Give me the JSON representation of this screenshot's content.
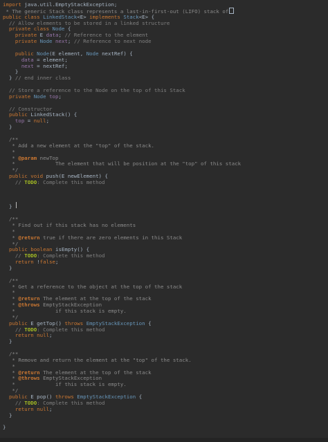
{
  "editor": {
    "language": "java",
    "colors": {
      "background": "#2b2b2b",
      "keyword": "#cc7832",
      "text": "#a9b7c6",
      "comment": "#808080",
      "field": "#9876aa",
      "todo": "#a8c023"
    },
    "lines": [
      {
        "parts": [
          {
            "c": "kw",
            "t": "import "
          },
          {
            "c": "plain",
            "t": "java.util.EmptyStackException;"
          }
        ]
      },
      {
        "parts": [
          {
            "c": "doc",
            "t": " * The generic Stack class represents a last-in-first-out (LIFO) stack of"
          }
        ],
        "box": true
      },
      {
        "parts": [
          {
            "c": "kw",
            "t": "public class "
          },
          {
            "c": "cls",
            "t": "LinkedStack"
          },
          {
            "c": "plain",
            "t": "<E> "
          },
          {
            "c": "kw",
            "t": "implements "
          },
          {
            "c": "cls",
            "t": "Stack"
          },
          {
            "c": "plain",
            "t": "<E> {"
          }
        ]
      },
      {
        "parts": [
          {
            "c": "cmt",
            "t": "  // Allow elements to be stored in a linked structure"
          }
        ]
      },
      {
        "parts": [
          {
            "c": "kw",
            "t": "  private class "
          },
          {
            "c": "cls",
            "t": "Node "
          },
          {
            "c": "plain",
            "t": "{"
          }
        ]
      },
      {
        "parts": [
          {
            "c": "kw",
            "t": "    private "
          },
          {
            "c": "plain",
            "t": "E "
          },
          {
            "c": "fld",
            "t": "data"
          },
          {
            "c": "plain",
            "t": "; "
          },
          {
            "c": "cmt",
            "t": "// Reference to the element"
          }
        ]
      },
      {
        "parts": [
          {
            "c": "kw",
            "t": "    private "
          },
          {
            "c": "cls",
            "t": "Node "
          },
          {
            "c": "fld",
            "t": "next"
          },
          {
            "c": "plain",
            "t": "; "
          },
          {
            "c": "cmt",
            "t": "// Reference to next node"
          }
        ]
      },
      {
        "parts": []
      },
      {
        "parts": [
          {
            "c": "kw",
            "t": "    public "
          },
          {
            "c": "cls",
            "t": "Node"
          },
          {
            "c": "plain",
            "t": "(E element, "
          },
          {
            "c": "cls",
            "t": "Node "
          },
          {
            "c": "plain",
            "t": "nextRef) {"
          }
        ]
      },
      {
        "parts": [
          {
            "c": "fld",
            "t": "      data "
          },
          {
            "c": "plain",
            "t": "= element;"
          }
        ]
      },
      {
        "parts": [
          {
            "c": "fld",
            "t": "      next "
          },
          {
            "c": "plain",
            "t": "= nextRef;"
          }
        ]
      },
      {
        "parts": [
          {
            "c": "plain",
            "t": "    }"
          }
        ]
      },
      {
        "parts": [
          {
            "c": "plain",
            "t": "  } "
          },
          {
            "c": "cmt",
            "t": "// end inner class"
          }
        ]
      },
      {
        "parts": []
      },
      {
        "parts": [
          {
            "c": "cmt",
            "t": "  // Store a reference to the Node on the top of this Stack"
          }
        ]
      },
      {
        "parts": [
          {
            "c": "kw",
            "t": "  private "
          },
          {
            "c": "cls",
            "t": "Node "
          },
          {
            "c": "fld",
            "t": "top"
          },
          {
            "c": "plain",
            "t": ";"
          }
        ]
      },
      {
        "parts": []
      },
      {
        "parts": [
          {
            "c": "cmt",
            "t": "  // Constructor"
          }
        ]
      },
      {
        "parts": [
          {
            "c": "kw",
            "t": "  public "
          },
          {
            "c": "plain",
            "t": "LinkedStack() {"
          }
        ]
      },
      {
        "parts": [
          {
            "c": "fld",
            "t": "    top "
          },
          {
            "c": "plain",
            "t": "= "
          },
          {
            "c": "kw",
            "t": "null"
          },
          {
            "c": "plain",
            "t": ";"
          }
        ]
      },
      {
        "parts": [
          {
            "c": "plain",
            "t": "  }"
          }
        ]
      },
      {
        "parts": []
      },
      {
        "parts": [
          {
            "c": "doc",
            "t": "  /**"
          }
        ]
      },
      {
        "parts": [
          {
            "c": "doc",
            "t": "   * Add a new element at the \"top\" of the stack."
          }
        ]
      },
      {
        "parts": [
          {
            "c": "doc",
            "t": "   *"
          }
        ]
      },
      {
        "parts": [
          {
            "c": "doc",
            "t": "   * "
          },
          {
            "c": "tag",
            "t": "@param "
          },
          {
            "c": "doc",
            "t": "newTop"
          }
        ]
      },
      {
        "parts": [
          {
            "c": "doc",
            "t": "   *             The element that will be position at the \"top\" of this stack"
          }
        ]
      },
      {
        "parts": [
          {
            "c": "doc",
            "t": "   */"
          }
        ]
      },
      {
        "parts": [
          {
            "c": "kw",
            "t": "  public void "
          },
          {
            "c": "plain",
            "t": "push(E newElement) {"
          }
        ]
      },
      {
        "parts": [
          {
            "c": "cmt",
            "t": "    // "
          },
          {
            "c": "todo",
            "t": "TODO"
          },
          {
            "c": "cmt",
            "t": ": Complete this method"
          }
        ]
      },
      {
        "parts": []
      },
      {
        "parts": []
      },
      {
        "parts": []
      },
      {
        "parts": [
          {
            "c": "plain",
            "t": "  }"
          }
        ]
      },
      {
        "parts": []
      },
      {
        "parts": [
          {
            "c": "doc",
            "t": "  /**"
          }
        ]
      },
      {
        "parts": [
          {
            "c": "doc",
            "t": "   * Find out if this stack has no elements"
          }
        ]
      },
      {
        "parts": [
          {
            "c": "doc",
            "t": "   *"
          }
        ]
      },
      {
        "parts": [
          {
            "c": "doc",
            "t": "   * "
          },
          {
            "c": "tag",
            "t": "@return "
          },
          {
            "c": "doc",
            "t": "true if there are zero elements in this Stack"
          }
        ]
      },
      {
        "parts": [
          {
            "c": "doc",
            "t": "   */"
          }
        ]
      },
      {
        "parts": [
          {
            "c": "kw",
            "t": "  public boolean "
          },
          {
            "c": "plain",
            "t": "isEmpty() {"
          }
        ]
      },
      {
        "parts": [
          {
            "c": "cmt",
            "t": "    // "
          },
          {
            "c": "todo",
            "t": "TODO"
          },
          {
            "c": "cmt",
            "t": ": Complete this method"
          }
        ]
      },
      {
        "parts": [
          {
            "c": "kw",
            "t": "    return "
          },
          {
            "c": "plain",
            "t": "!"
          },
          {
            "c": "kw",
            "t": "false"
          },
          {
            "c": "plain",
            "t": ";"
          }
        ]
      },
      {
        "parts": [
          {
            "c": "plain",
            "t": "  }"
          }
        ]
      },
      {
        "parts": []
      },
      {
        "parts": [
          {
            "c": "doc",
            "t": "  /**"
          }
        ]
      },
      {
        "parts": [
          {
            "c": "doc",
            "t": "   * Get a reference to the object at the top of the stack"
          }
        ]
      },
      {
        "parts": [
          {
            "c": "doc",
            "t": "   *"
          }
        ]
      },
      {
        "parts": [
          {
            "c": "doc",
            "t": "   * "
          },
          {
            "c": "tag",
            "t": "@return "
          },
          {
            "c": "doc",
            "t": "The element at the top of the stack"
          }
        ]
      },
      {
        "parts": [
          {
            "c": "doc",
            "t": "   * "
          },
          {
            "c": "tag",
            "t": "@throws "
          },
          {
            "c": "doc",
            "t": "EmptyStackException"
          }
        ]
      },
      {
        "parts": [
          {
            "c": "doc",
            "t": "   *             if this stack is empty."
          }
        ]
      },
      {
        "parts": [
          {
            "c": "doc",
            "t": "   */"
          }
        ]
      },
      {
        "parts": [
          {
            "c": "kw",
            "t": "  public "
          },
          {
            "c": "plain",
            "t": "E getTop() "
          },
          {
            "c": "kw",
            "t": "throws "
          },
          {
            "c": "cls",
            "t": "EmptyStackException "
          },
          {
            "c": "plain",
            "t": "{"
          }
        ]
      },
      {
        "parts": [
          {
            "c": "cmt",
            "t": "    // "
          },
          {
            "c": "todo",
            "t": "TODO"
          },
          {
            "c": "cmt",
            "t": ": Complete this method"
          }
        ]
      },
      {
        "parts": [
          {
            "c": "kw",
            "t": "    return null"
          },
          {
            "c": "plain",
            "t": ";"
          }
        ]
      },
      {
        "parts": [
          {
            "c": "plain",
            "t": "  }"
          }
        ]
      },
      {
        "parts": []
      },
      {
        "parts": [
          {
            "c": "doc",
            "t": "  /**"
          }
        ]
      },
      {
        "parts": [
          {
            "c": "doc",
            "t": "   * Remove and return the element at the \"top\" of the stack."
          }
        ]
      },
      {
        "parts": [
          {
            "c": "doc",
            "t": "   *"
          }
        ]
      },
      {
        "parts": [
          {
            "c": "doc",
            "t": "   * "
          },
          {
            "c": "tag",
            "t": "@return "
          },
          {
            "c": "doc",
            "t": "The element at the top of the stack"
          }
        ]
      },
      {
        "parts": [
          {
            "c": "doc",
            "t": "   * "
          },
          {
            "c": "tag",
            "t": "@throws "
          },
          {
            "c": "doc",
            "t": "EmptyStackException"
          }
        ]
      },
      {
        "parts": [
          {
            "c": "doc",
            "t": "   *             if this stack is empty."
          }
        ]
      },
      {
        "parts": [
          {
            "c": "doc",
            "t": "   */"
          }
        ]
      },
      {
        "parts": [
          {
            "c": "kw",
            "t": "  public "
          },
          {
            "c": "plain",
            "t": "E pop() "
          },
          {
            "c": "kw",
            "t": "throws "
          },
          {
            "c": "cls",
            "t": "EmptyStackException "
          },
          {
            "c": "plain",
            "t": "{"
          }
        ]
      },
      {
        "parts": [
          {
            "c": "cmt",
            "t": "    // "
          },
          {
            "c": "todo",
            "t": "TODO"
          },
          {
            "c": "cmt",
            "t": ": Complete this method"
          }
        ]
      },
      {
        "parts": [
          {
            "c": "kw",
            "t": "    return null"
          },
          {
            "c": "plain",
            "t": ";"
          }
        ]
      },
      {
        "parts": [
          {
            "c": "plain",
            "t": "  }"
          }
        ]
      },
      {
        "parts": []
      },
      {
        "parts": [
          {
            "c": "plain",
            "t": "}"
          }
        ]
      }
    ]
  }
}
